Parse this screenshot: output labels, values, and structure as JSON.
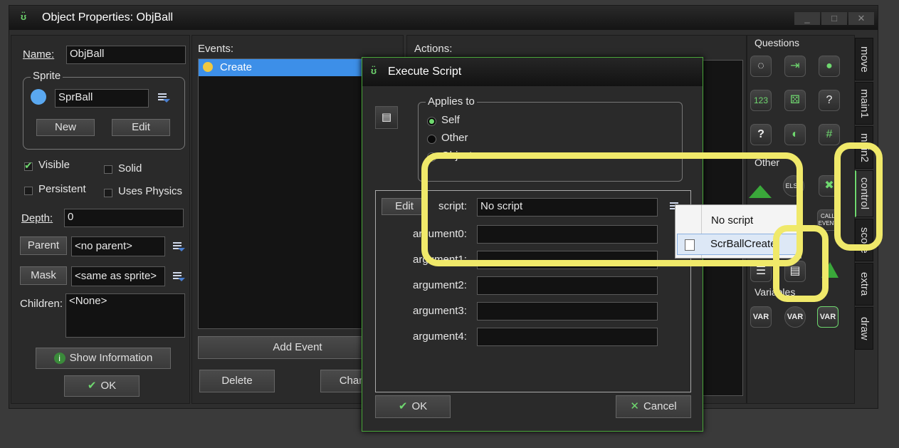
{
  "window": {
    "title": "Object Properties: ObjBall",
    "controls": {
      "minimize": "_",
      "maximize": "□",
      "close": "✕"
    }
  },
  "props": {
    "name_label": "Name:",
    "name_value": "ObjBall",
    "sprite_group": "Sprite",
    "sprite_value": "SprBall",
    "new_button": "New",
    "edit_button": "Edit",
    "visible_label": "Visible",
    "solid_label": "Solid",
    "persistent_label": "Persistent",
    "uses_physics_label": "Uses Physics",
    "depth_label": "Depth:",
    "depth_value": "0",
    "parent_button": "Parent",
    "parent_value": "<no parent>",
    "mask_button": "Mask",
    "mask_value": "<same as sprite>",
    "children_label": "Children:",
    "children_value": "<None>",
    "show_info_button": "Show Information",
    "ok_button": "OK",
    "visible_checked": true,
    "solid_checked": false,
    "persistent_checked": false,
    "uses_physics_checked": false
  },
  "events": {
    "label": "Events:",
    "items": [
      "Create"
    ],
    "add_event": "Add Event",
    "delete": "Delete",
    "change": "Change"
  },
  "actions": {
    "label": "Actions:"
  },
  "library": {
    "questions_label": "Questions",
    "other_label": "Other",
    "variables_label": "Variables",
    "else_label": "ELSE",
    "call_event_label": "CALL EVENT",
    "var_label": "VAR",
    "tabs": [
      "move",
      "main1",
      "main2",
      "control",
      "score",
      "extra",
      "draw"
    ]
  },
  "dialog": {
    "title": "Execute Script",
    "applies_to_label": "Applies to",
    "self_label": "Self",
    "other_label": "Other",
    "object_label": "Object:",
    "edit_button": "Edit",
    "script_label": "script:",
    "script_value": "No script",
    "argument_labels": [
      "argument0:",
      "argument1:",
      "argument2:",
      "argument3:",
      "argument4:"
    ],
    "ok_button": "OK",
    "cancel_button": "Cancel"
  },
  "dropdown": {
    "items": [
      "No script",
      "ScrBallCreate"
    ]
  },
  "colors": {
    "accent_green": "#6fd86f",
    "highlight_yellow": "#f0e96a",
    "selection_blue": "#3d8fe8"
  }
}
